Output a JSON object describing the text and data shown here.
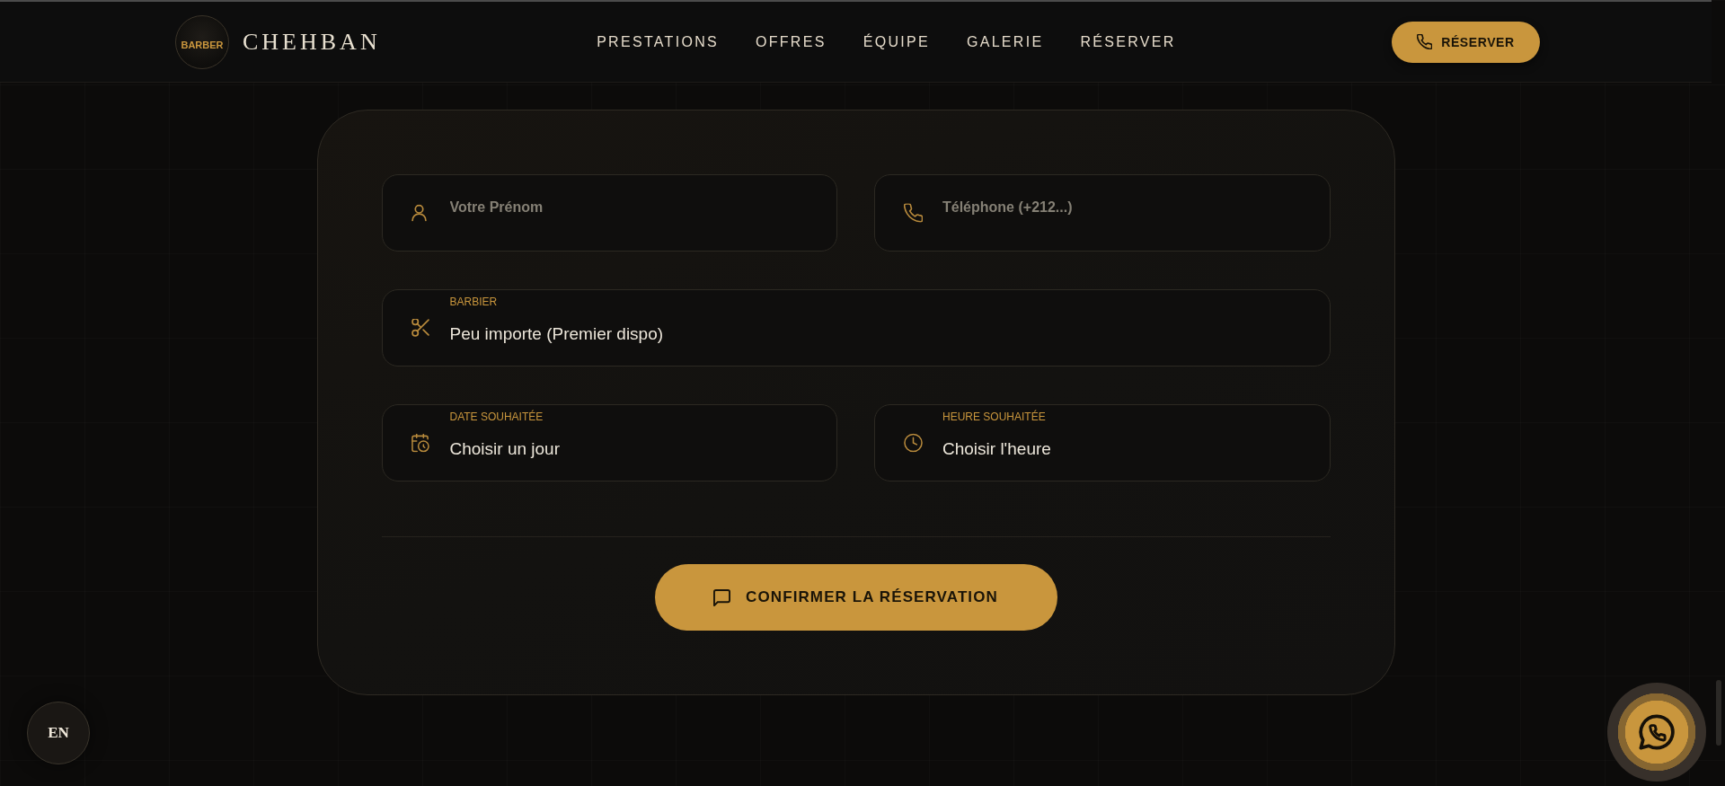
{
  "header": {
    "logo_text": "BARBER",
    "brand": "CHEHBAN",
    "nav": [
      {
        "label": "PRESTATIONS"
      },
      {
        "label": "OFFRES"
      },
      {
        "label": "ÉQUIPE"
      },
      {
        "label": "GALERIE"
      },
      {
        "label": "RÉSERVER"
      }
    ],
    "cta": {
      "label": "RÉSERVER"
    }
  },
  "booking_form": {
    "rows": [
      {
        "fields": [
          {
            "kind": "input",
            "placeholder": "Votre Prénom"
          },
          {
            "kind": "input",
            "placeholder": "Téléphone (+212...)"
          }
        ]
      },
      {
        "fields": [
          {
            "kind": "select",
            "label": "BARBIER",
            "value": "Peu importe (Premier dispo)"
          }
        ]
      },
      {
        "fields": [
          {
            "kind": "select",
            "label": "DATE SOUHAITÉE",
            "value": "Choisir un jour"
          },
          {
            "kind": "select",
            "label": "HEURE SOUHAITÉE",
            "value": "Choisir l'heure"
          }
        ]
      }
    ],
    "submit": {
      "label": "CONFIRMER LA RÉSERVATION"
    }
  },
  "language_toggle": {
    "label": "EN"
  }
}
